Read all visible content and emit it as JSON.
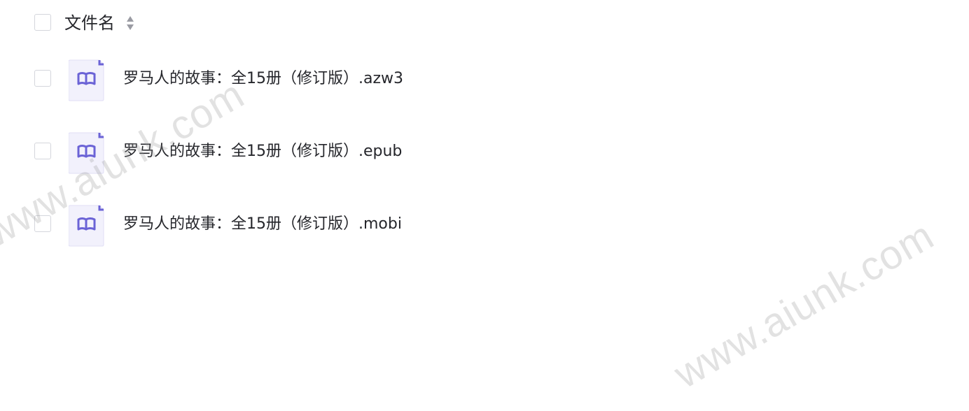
{
  "header": {
    "select_all_checked": false,
    "column_label": "文件名",
    "sort_icon": "sort-updown-icon"
  },
  "files": [
    {
      "name": "罗马人的故事：全15册（修订版）.azw3",
      "icon": "book-icon",
      "checked": false
    },
    {
      "name": "罗马人的故事：全15册（修订版）.epub",
      "icon": "book-icon",
      "checked": false
    },
    {
      "name": "罗马人的故事：全15册（修订版）.mobi",
      "icon": "book-icon",
      "checked": false
    }
  ],
  "watermarks": [
    "www.aiunk.com",
    "www.aiunk.com"
  ],
  "colors": {
    "text": "#25262b",
    "checkbox_border": "#d4d6dc",
    "icon_bg": "#f2f1fc",
    "icon_accent": "#6b63d6",
    "sort_icon": "#9a9ba3",
    "watermark": "#969696"
  }
}
